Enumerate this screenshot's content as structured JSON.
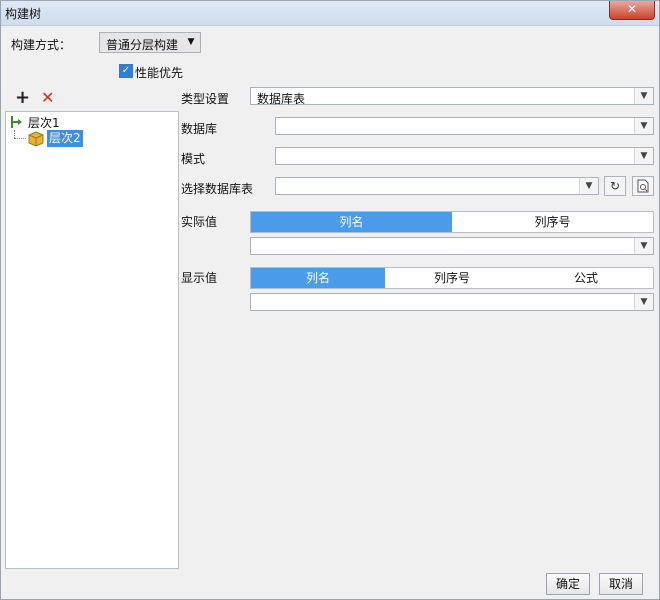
{
  "window": {
    "title": "构建树",
    "close_icon": "close-icon"
  },
  "build": {
    "label": "构建方式：",
    "selected": "普通分层构建"
  },
  "performance": {
    "label": "性能优先",
    "checked": true
  },
  "toolbar": {
    "add_icon": "plus-icon",
    "delete_icon": "x-icon"
  },
  "tree": {
    "items": [
      {
        "label": "层次1",
        "icon": "level-icon"
      },
      {
        "label": "层次2",
        "icon": "cube-icon"
      }
    ]
  },
  "form": {
    "type_label": "类型设置",
    "type_value": "数据库表",
    "db_label": "数据库",
    "db_value": "",
    "schema_label": "模式",
    "schema_value": "",
    "table_label": "选择数据库表",
    "table_value": "",
    "actual_label": "实际值",
    "actual_tabs": [
      "列名",
      "列序号"
    ],
    "display_label": "显示值",
    "display_tabs": [
      "列名",
      "列序号",
      "公式"
    ],
    "refresh_icon": "refresh-icon",
    "preview_icon": "preview-icon"
  },
  "buttons": {
    "ok": "确定",
    "cancel": "取消"
  }
}
